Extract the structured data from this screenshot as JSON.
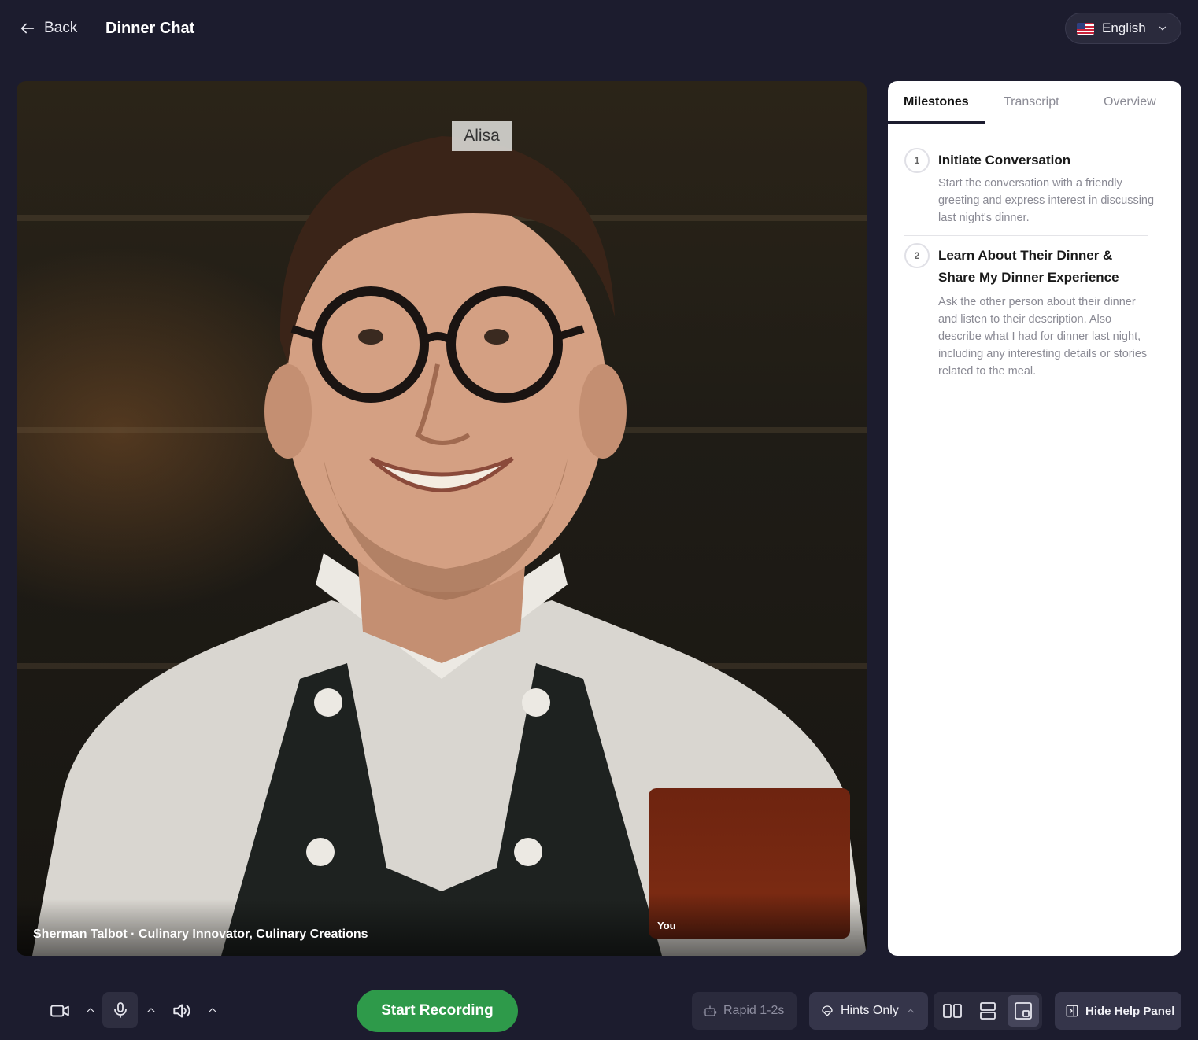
{
  "header": {
    "back_label": "Back",
    "title": "Dinner Chat",
    "language": "English"
  },
  "video": {
    "ai_name_tag": "Alisa",
    "caption": "Sherman Talbot · Culinary Innovator, Culinary Creations",
    "self_label": "You"
  },
  "panel": {
    "tabs": [
      {
        "label": "Milestones",
        "active": true
      },
      {
        "label": "Transcript",
        "active": false
      },
      {
        "label": "Overview",
        "active": false
      }
    ],
    "milestones": [
      {
        "number": "1",
        "title": "Initiate Conversation",
        "description": "Start the conversation with a friendly greeting and express interest in discussing last night's dinner."
      },
      {
        "number": "2",
        "title": "Learn About Their Dinner & Share My Dinner Experience",
        "description": "Ask the other person about their dinner and listen to their description. Also describe what I had for dinner last night, including any interesting details or stories related to the meal."
      }
    ]
  },
  "controls": {
    "record_label": "Start Recording",
    "speed_label": "Rapid 1-2s",
    "hints_label": "Hints Only",
    "help_label": "Hide Help Panel"
  },
  "colors": {
    "background": "#1c1c2e",
    "record_button": "#2e9a4a",
    "self_view": "#7a2a12"
  }
}
